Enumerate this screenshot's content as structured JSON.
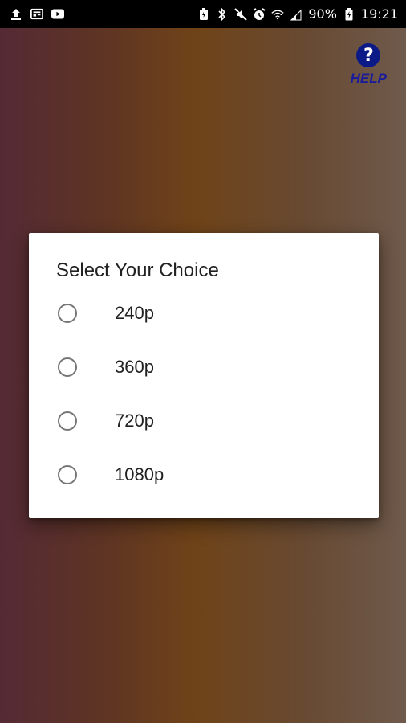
{
  "status_bar": {
    "battery_percent": "90%",
    "time": "19:21",
    "icons_left": [
      "upload-icon",
      "news-icon",
      "youtube-icon"
    ],
    "icons_right": [
      "battery-saver-icon",
      "bluetooth-icon",
      "mute-icon",
      "alarm-icon",
      "wifi-icon",
      "signal-icon",
      "battery-icon"
    ]
  },
  "help": {
    "icon": "question-mark-icon",
    "symbol": "?",
    "label": "HELP",
    "color": "#0b1a86"
  },
  "dialog": {
    "title": "Select Your Choice",
    "options": [
      {
        "label": "240p",
        "selected": false
      },
      {
        "label": "360p",
        "selected": false
      },
      {
        "label": "720p",
        "selected": false
      },
      {
        "label": "1080p",
        "selected": false
      }
    ]
  }
}
